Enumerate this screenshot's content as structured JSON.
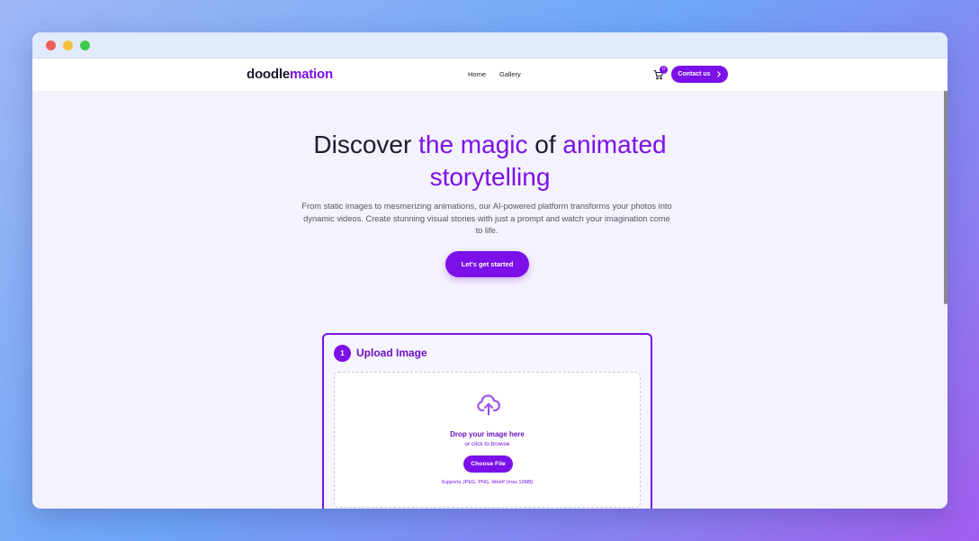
{
  "window": {
    "controls": [
      "close",
      "minimize",
      "maximize"
    ]
  },
  "nav": {
    "logo_main": "doodle",
    "logo_accent": "mation",
    "links": [
      "Home",
      "Gallery"
    ],
    "cart_count": "0",
    "cart_icon": "cart-icon",
    "contact_label": "Contact us",
    "contact_icon": "chevron-right-icon"
  },
  "hero": {
    "title_1": "Discover ",
    "title_2": "the magic",
    "title_3": " of ",
    "title_4": "animated",
    "title_5": "storytelling",
    "description": "From static images to mesmerizing animations, our AI-powered platform transforms your photos into dynamic videos. Create stunning visual stories with just a prompt and watch your imagination come to life.",
    "cta_label": "Let's get started"
  },
  "upload": {
    "step_number": "1",
    "step_title": "Upload Image",
    "icon": "cloud-upload-icon",
    "drop_title": "Drop your image here",
    "drop_subtitle": "or click to browse",
    "choose_label": "Choose File",
    "supports": "Supports JPEG, PNG, WebP (max 10MB)"
  },
  "colors": {
    "accent": "#7b10e8",
    "page_bg": "#f4f2fd",
    "text_dark": "#1d1b2e"
  }
}
